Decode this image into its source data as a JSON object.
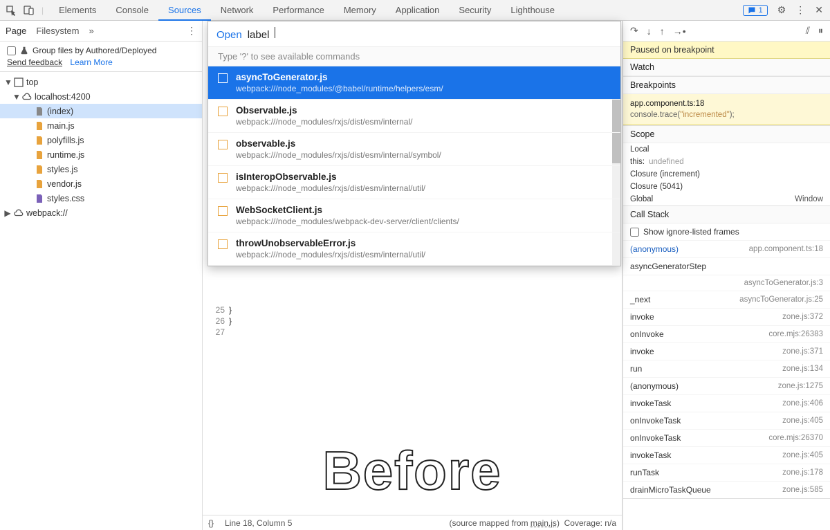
{
  "topTabs": [
    "Elements",
    "Console",
    "Sources",
    "Network",
    "Performance",
    "Memory",
    "Application",
    "Security",
    "Lighthouse"
  ],
  "topActive": "Sources",
  "messageCount": "1",
  "leftTabs": [
    "Page",
    "Filesystem"
  ],
  "leftActive": "Page",
  "groupLabel": "Group files by Authored/Deployed",
  "feedback": "Send feedback",
  "learnMore": "Learn More",
  "tree": [
    {
      "indent": 0,
      "arrow": "▼",
      "icon": "frame",
      "label": "top"
    },
    {
      "indent": 1,
      "arrow": "▼",
      "icon": "cloud",
      "label": "localhost:4200"
    },
    {
      "indent": 2,
      "arrow": "",
      "icon": "doc",
      "label": "(index)",
      "selected": true
    },
    {
      "indent": 2,
      "arrow": "",
      "icon": "js",
      "label": "main.js"
    },
    {
      "indent": 2,
      "arrow": "",
      "icon": "js",
      "label": "polyfills.js"
    },
    {
      "indent": 2,
      "arrow": "",
      "icon": "js",
      "label": "runtime.js"
    },
    {
      "indent": 2,
      "arrow": "",
      "icon": "js",
      "label": "styles.js"
    },
    {
      "indent": 2,
      "arrow": "",
      "icon": "js",
      "label": "vendor.js"
    },
    {
      "indent": 2,
      "arrow": "",
      "icon": "css",
      "label": "styles.css"
    },
    {
      "indent": 0,
      "arrow": "▶",
      "icon": "cloud",
      "label": "webpack://"
    }
  ],
  "commandMenu": {
    "openLabel": "Open",
    "query": "label",
    "help": "Type '?' to see available commands",
    "items": [
      {
        "name": "asyncToGenerator.js",
        "path": "webpack:///node_modules/@babel/runtime/helpers/esm/",
        "active": true
      },
      {
        "name": "Observable.js",
        "path": "webpack:///node_modules/rxjs/dist/esm/internal/"
      },
      {
        "name": "observable.js",
        "path": "webpack:///node_modules/rxjs/dist/esm/internal/symbol/"
      },
      {
        "name": "isInteropObservable.js",
        "path": "webpack:///node_modules/rxjs/dist/esm/internal/util/"
      },
      {
        "name": "WebSocketClient.js",
        "path": "webpack:///node_modules/webpack-dev-server/client/clients/"
      },
      {
        "name": "throwUnobservableError.js",
        "path": "webpack:///node_modules/rxjs/dist/esm/internal/util/"
      }
    ]
  },
  "codeLines": [
    {
      "n": "25",
      "t": "  }"
    },
    {
      "n": "26",
      "t": "}"
    },
    {
      "n": "27",
      "t": ""
    }
  ],
  "overlayText": "Before",
  "status": {
    "brackets": "{}",
    "pos": "Line 18, Column 5",
    "mapped": "(source mapped from ",
    "mappedFile": "main.js",
    "mappedEnd": ")",
    "coverage": "Coverage: n/a"
  },
  "pauseMsg": "Paused on breakpoint",
  "sections": {
    "watch": "Watch",
    "breakpoints": "Breakpoints",
    "scope": "Scope",
    "callstack": "Call Stack"
  },
  "breakpoint": {
    "line1": "app.component.ts:18",
    "line2a": "console.trace(",
    "line2b": "\"incremented\"",
    "line2c": ");"
  },
  "scope": [
    {
      "l": "Local",
      "r": ""
    },
    {
      "l": "this:",
      "v": "undefined"
    },
    {
      "l": "Closure (increment)",
      "r": ""
    },
    {
      "l": "Closure (5041)",
      "r": ""
    },
    {
      "l": "Global",
      "r": "Window"
    }
  ],
  "ignoreListed": "Show ignore-listed frames",
  "stack": [
    {
      "fn": "(anonymous)",
      "loc": "app.component.ts:18",
      "active": true
    },
    {
      "fn": "asyncGeneratorStep",
      "loc": ""
    },
    {
      "fn": "",
      "loc": "asyncToGenerator.js:3"
    },
    {
      "fn": "_next",
      "loc": "asyncToGenerator.js:25"
    },
    {
      "fn": "invoke",
      "loc": "zone.js:372"
    },
    {
      "fn": "onInvoke",
      "loc": "core.mjs:26383"
    },
    {
      "fn": "invoke",
      "loc": "zone.js:371"
    },
    {
      "fn": "run",
      "loc": "zone.js:134"
    },
    {
      "fn": "(anonymous)",
      "loc": "zone.js:1275"
    },
    {
      "fn": "invokeTask",
      "loc": "zone.js:406"
    },
    {
      "fn": "onInvokeTask",
      "loc": "zone.js:405"
    },
    {
      "fn": "onInvokeTask",
      "loc": "core.mjs:26370"
    },
    {
      "fn": "invokeTask",
      "loc": "zone.js:405"
    },
    {
      "fn": "runTask",
      "loc": "zone.js:178"
    },
    {
      "fn": "drainMicroTaskQueue",
      "loc": "zone.js:585"
    }
  ]
}
